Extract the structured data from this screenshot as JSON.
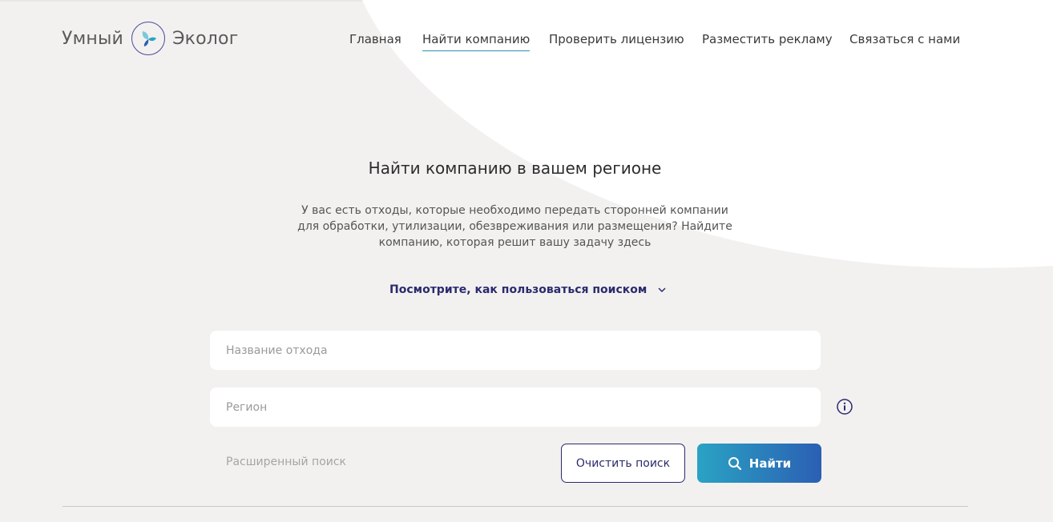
{
  "brand": {
    "word_left": "Умный",
    "word_right": "Эколог",
    "logo_icon": "leaf-icon"
  },
  "nav": {
    "items": [
      {
        "label": "Главная"
      },
      {
        "label": "Найти компанию",
        "active": true
      },
      {
        "label": "Проверить лицензию"
      },
      {
        "label": "Разместить рекламу"
      },
      {
        "label": "Связаться с нами"
      }
    ]
  },
  "hero": {
    "title": "Найти компанию в вашем регионе",
    "description_lines": [
      "У вас есть отходы, которые необходимо передать сторонней компании",
      "для обработки, утилизации, обезвреживания или размещения? Найдите",
      "компанию, которая решит вашу задачу здесь"
    ],
    "howto_label": "Посмотрите, как пользоваться поиском"
  },
  "search": {
    "waste_placeholder": "Название отхода",
    "region_placeholder": "Регион",
    "advanced_label": "Расширенный поиск",
    "clear_label": "Очистить поиск",
    "find_label": "Найти"
  },
  "colors": {
    "accent": "#2b2a6e",
    "gradient_start": "#2aa3c4",
    "gradient_end": "#2b5fb3",
    "background": "#f2f1f0",
    "active_underline": "#2c8fb4"
  }
}
